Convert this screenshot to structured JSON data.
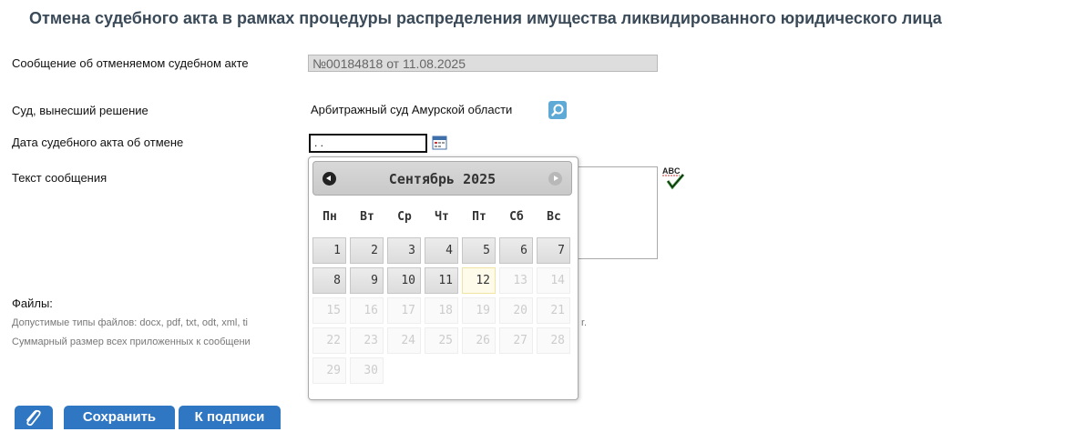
{
  "page": {
    "title": "Отмена судебного акта в рамках процедуры распределения имущества ликвидированного юридического лица"
  },
  "form": {
    "message_label": "Сообщение об отменяемом судебном акте",
    "message_value": "№00184818 от 11.08.2025",
    "court_label": "Суд, вынесший решение",
    "court_value": "Арбитражный суд Амурской области",
    "date_label": "Дата судебного акта об отмене",
    "date_value": ". .",
    "text_label": "Текст сообщения"
  },
  "files": {
    "label": "Файлы:",
    "types_note": "Допустимые типы файлов: docx, pdf, txt, odt, xml, ti",
    "types_note_tail": "r.",
    "size_note": "Суммарный размер всех приложенных к сообщени"
  },
  "buttons": {
    "save": "Сохранить",
    "sign": "К подписи"
  },
  "datepicker": {
    "month_title": "Сентябрь 2025",
    "weekdays": [
      "Пн",
      "Вт",
      "Ср",
      "Чт",
      "Пт",
      "Сб",
      "Вс"
    ],
    "weeks": [
      [
        "1",
        "2",
        "3",
        "4",
        "5",
        "6",
        "7"
      ],
      [
        "8",
        "9",
        "10",
        "11",
        "12",
        "13",
        "14"
      ],
      [
        "15",
        "16",
        "17",
        "18",
        "19",
        "20",
        "21"
      ],
      [
        "22",
        "23",
        "24",
        "25",
        "26",
        "27",
        "28"
      ],
      [
        "29",
        "30"
      ]
    ],
    "today": "12",
    "last_enabled": "12"
  },
  "colors": {
    "accent": "#2f76c3",
    "title": "#3a4a58"
  },
  "icons": [
    "magnifier-icon",
    "calendar-icon",
    "spellcheck-icon",
    "paperclip-icon",
    "prev-month-icon",
    "next-month-icon"
  ]
}
